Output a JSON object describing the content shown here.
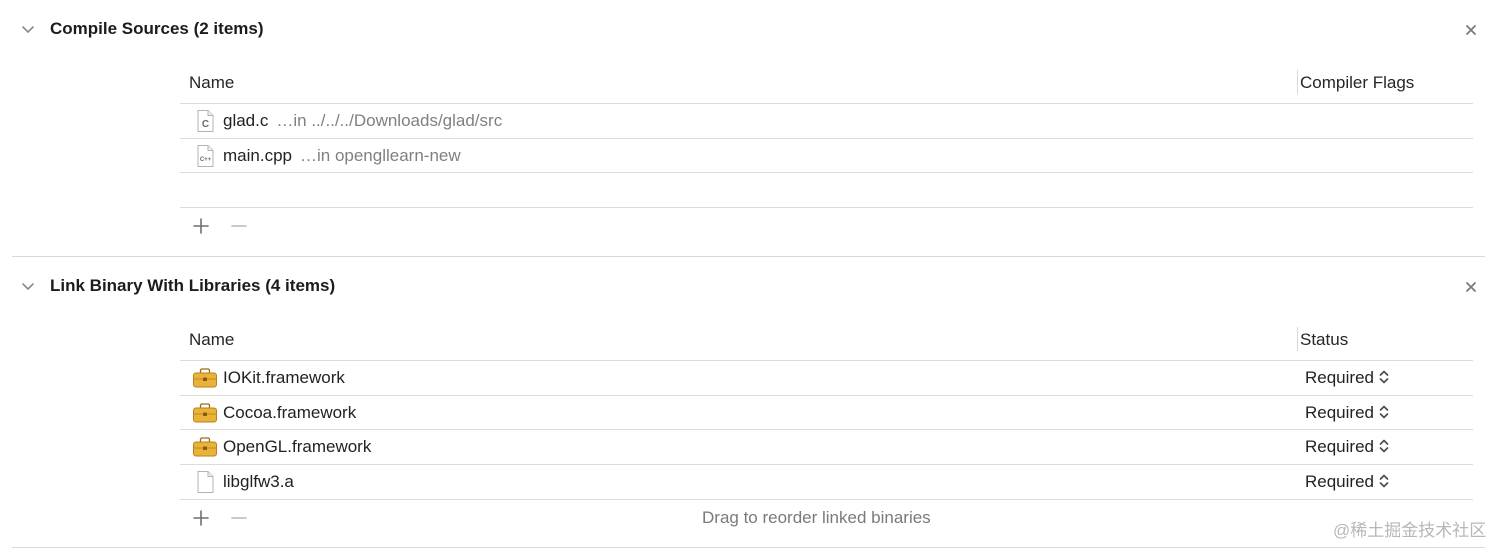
{
  "compile_sources": {
    "title": "Compile Sources (2 items)",
    "columns": {
      "name": "Name",
      "flags": "Compiler Flags"
    },
    "rows": [
      {
        "name": "glad.c",
        "path": "…in ../../../Downloads/glad/src",
        "icon": "c-source-file-icon"
      },
      {
        "name": "main.cpp",
        "path": "…in opengllearn-new",
        "icon": "cpp-source-file-icon"
      }
    ],
    "add_label": "+",
    "remove_label": "−"
  },
  "link_libraries": {
    "title": "Link Binary With Libraries (4 items)",
    "columns": {
      "name": "Name",
      "status": "Status"
    },
    "rows": [
      {
        "name": "IOKit.framework",
        "status": "Required",
        "icon": "framework-icon"
      },
      {
        "name": "Cocoa.framework",
        "status": "Required",
        "icon": "framework-icon"
      },
      {
        "name": "OpenGL.framework",
        "status": "Required",
        "icon": "framework-icon"
      },
      {
        "name": "libglfw3.a",
        "status": "Required",
        "icon": "library-file-icon"
      }
    ],
    "hint": "Drag to reorder linked binaries"
  },
  "watermark": "@稀土掘金技术社区",
  "colors": {
    "framework": "#e9b23a",
    "separator": "#dcdcdc",
    "secondary_text": "#808080"
  }
}
